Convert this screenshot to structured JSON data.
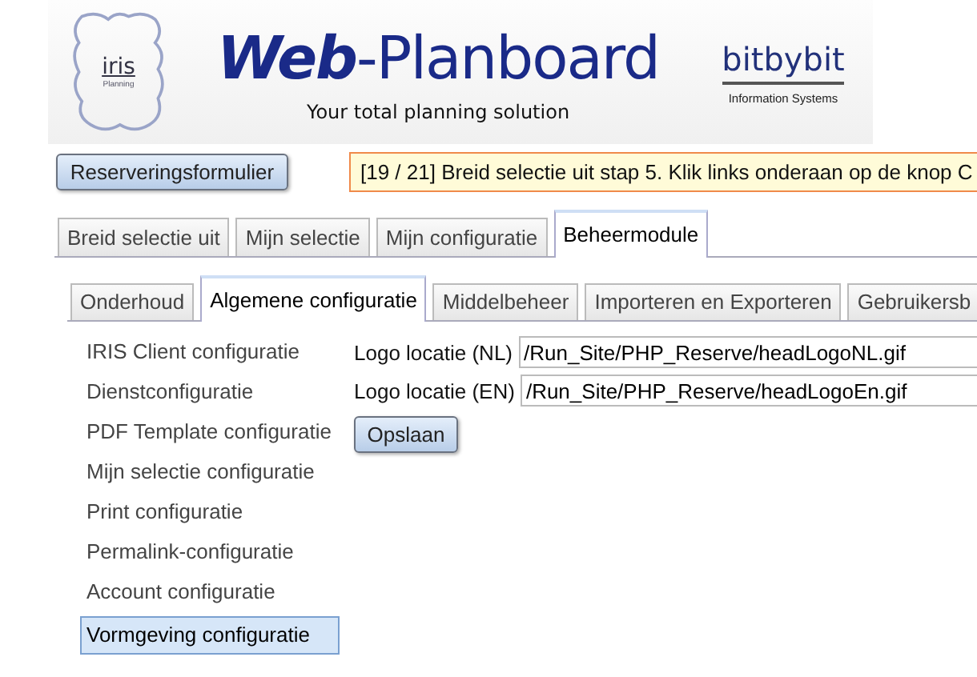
{
  "header": {
    "iris_logo": {
      "name": "iris",
      "subtitle": "Planning"
    },
    "brand": {
      "bold": "Web",
      "rest": "-Planboard"
    },
    "tagline": "Your total planning solution",
    "company": {
      "name": "bitbybit",
      "subtitle": "Information Systems"
    }
  },
  "reservation_button": "Reserveringsformulier",
  "notice": "[19 / 21] Breid selectie uit stap 5. Klik links onderaan op de knop C",
  "tabs": [
    {
      "label": "Breid selectie uit",
      "selected": false
    },
    {
      "label": "Mijn selectie",
      "selected": false
    },
    {
      "label": "Mijn configuratie",
      "selected": false
    },
    {
      "label": "Beheermodule",
      "selected": true
    }
  ],
  "subtabs": [
    {
      "label": "Onderhoud",
      "selected": false
    },
    {
      "label": "Algemene configuratie",
      "selected": true
    },
    {
      "label": "Middelbeheer",
      "selected": false
    },
    {
      "label": "Importeren en Exporteren",
      "selected": false
    },
    {
      "label": "Gebruikersb",
      "selected": false
    }
  ],
  "sidebar": {
    "items": [
      {
        "label": "IRIS Client configuratie",
        "selected": false
      },
      {
        "label": "Dienstconfiguratie",
        "selected": false
      },
      {
        "label": "PDF Template configuratie",
        "selected": false
      },
      {
        "label": "Mijn selectie configuratie",
        "selected": false
      },
      {
        "label": "Print configuratie",
        "selected": false
      },
      {
        "label": "Permalink-configuratie",
        "selected": false
      },
      {
        "label": "Account configuratie",
        "selected": false
      },
      {
        "label": "Vormgeving configuratie",
        "selected": true
      }
    ]
  },
  "form": {
    "fields": [
      {
        "label": "Logo locatie (NL)",
        "value": "/Run_Site/PHP_Reserve/headLogoNL.gif"
      },
      {
        "label": "Logo locatie (EN)",
        "value": "/Run_Site/PHP_Reserve/headLogoEn.gif"
      }
    ],
    "save_button": "Opslaan"
  }
}
